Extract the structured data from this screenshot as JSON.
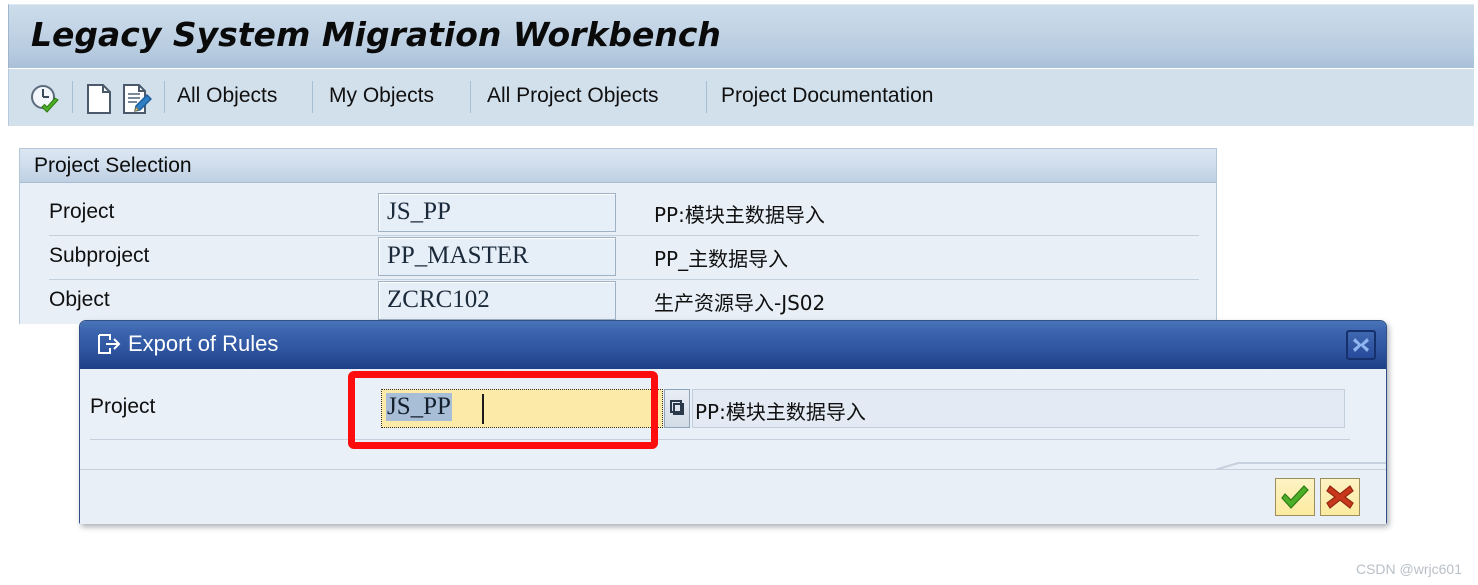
{
  "window": {
    "title": "Legacy System Migration Workbench"
  },
  "toolbar": {
    "icons": [
      {
        "name": "execute-clock-check-icon",
        "label": ""
      },
      {
        "name": "new-document-icon",
        "label": ""
      },
      {
        "name": "edit-document-icon",
        "label": ""
      }
    ],
    "menu_items": [
      {
        "label": "All Objects"
      },
      {
        "label": "My Objects"
      },
      {
        "label": "All Project Objects"
      },
      {
        "label": "Project Documentation"
      }
    ]
  },
  "panel": {
    "header": "Project Selection",
    "rows": [
      {
        "label": "Project",
        "value": "JS_PP",
        "description": "PP:模块主数据导入"
      },
      {
        "label": "Subproject",
        "value": "PP_MASTER",
        "description": "PP_主数据导入"
      },
      {
        "label": "Object",
        "value": "ZCRC102",
        "description": "生产资源导入-JS02"
      }
    ]
  },
  "dialog": {
    "title": "Export of Rules",
    "title_icon": "export-icon",
    "close_icon": "close-icon",
    "row": {
      "label": "Project",
      "input_value": "JS_PP",
      "input_placeholder": "",
      "matchcode_icon": "matchcode-search-icon",
      "description": "PP:模块主数据导入"
    },
    "buttons": {
      "ok_icon": "check-icon",
      "ok_label": "",
      "cancel_icon": "cross-icon",
      "cancel_label": ""
    }
  },
  "annotation": {
    "highlight_color": "#fd0d0d"
  },
  "watermark": {
    "text": "CSDN @wrjc601"
  },
  "colors": {
    "title_banner": "#bdd0e2",
    "toolbar": "#d2e0ec",
    "panel_bg": "#e8eff7",
    "dialog_titlebar": "#2f55a0",
    "input_focus_bg": "#fbeaa8",
    "selection_bg": "#a8bed6"
  }
}
